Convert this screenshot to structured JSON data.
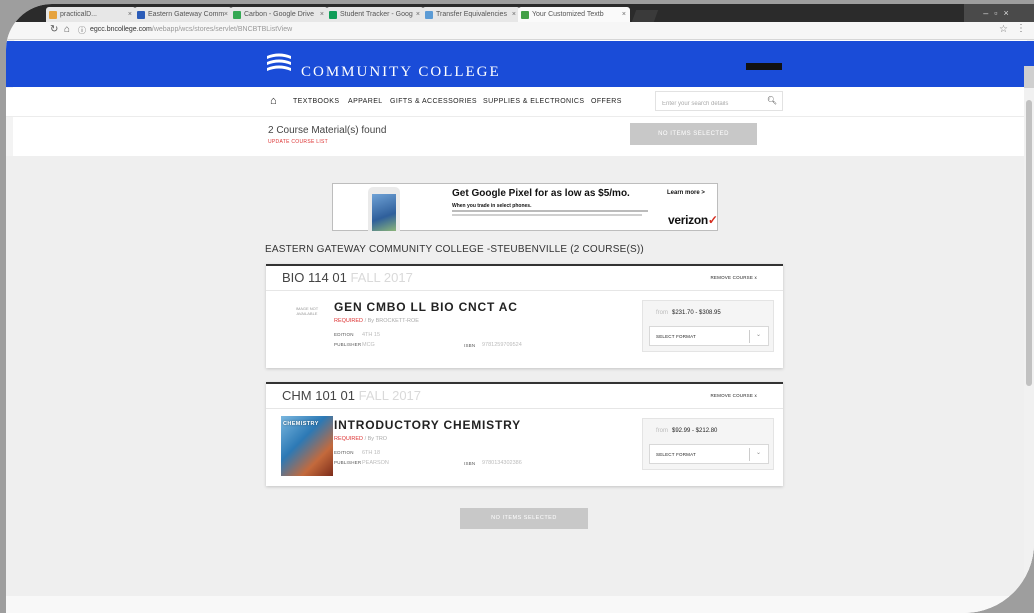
{
  "browser": {
    "tabs": [
      {
        "label": "practicalD...",
        "favicon_color": "#e6a23c"
      },
      {
        "label": "Eastern Gateway Comm",
        "favicon_color": "#2b5cb8"
      },
      {
        "label": "Carbon - Google Drive",
        "favicon_color": "#34a853"
      },
      {
        "label": "Student Tracker - Goog",
        "favicon_color": "#0f9d58"
      },
      {
        "label": "Transfer Equivalencies",
        "favicon_color": "#5b9bd5"
      },
      {
        "label": "Your Customized Textb",
        "favicon_color": "#43a047"
      }
    ],
    "url_host": "egcc.bncollege.com",
    "url_path": "/webapp/wcs/stores/servlet/BNCBTBListView"
  },
  "header": {
    "college_name": "COMMUNITY COLLEGE",
    "brand_color": "#1a4cd8"
  },
  "menu": {
    "items": [
      "TEXTBOOKS",
      "APPAREL",
      "GIFTS & ACCESSORIES",
      "SUPPLIES & ELECTRONICS",
      "OFFERS"
    ],
    "search_placeholder": "Enter your search details"
  },
  "results": {
    "found_text": "2  Course Material(s) found",
    "update_link": "UPDATE COURSE LIST",
    "no_items_label": "NO ITEMS SELECTED"
  },
  "ad": {
    "headline": "Get Google Pixel for as low as $5/mo.",
    "subline": "When you trade in select phones.",
    "cta": "Learn more >",
    "brand": "verizon"
  },
  "school_heading": "EASTERN GATEWAY COMMUNITY COLLEGE -STEUBENVILLE (2 COURSE(S))",
  "courses": [
    {
      "code": "BIO 114 01",
      "term": "FALL 2017",
      "remove_label": "REMOVE COURSE  x",
      "image_text": "IMAGE NOT AVAILABLE",
      "title": "GEN CMBO LL BIO CNCT AC",
      "required": "REQUIRED",
      "by": "/ By BROCKETT-ROE",
      "edition_label": "EDITION",
      "edition": "4TH 15",
      "publisher_label": "PUBLISHER",
      "publisher": "MCG",
      "isbn_label": "ISBN",
      "isbn": "9781259709524",
      "price_from": "from",
      "price_range": "$231.70 - $308.95",
      "select_label": "SELECT FORMAT"
    },
    {
      "code": "CHM 101 01",
      "term": "FALL 2017",
      "remove_label": "REMOVE COURSE  x",
      "cover_text": "CHEMISTRY",
      "title": "INTRODUCTORY CHEMISTRY",
      "required": "REQUIRED",
      "by": "/ By TRO",
      "edition_label": "EDITION",
      "edition": "6TH 18",
      "publisher_label": "PUBLISHER",
      "publisher": "PEARSON",
      "isbn_label": "ISBN",
      "isbn": "9780134302386",
      "price_from": "from",
      "price_range": "$92.99 - $212.80",
      "select_label": "SELECT FORMAT"
    }
  ]
}
